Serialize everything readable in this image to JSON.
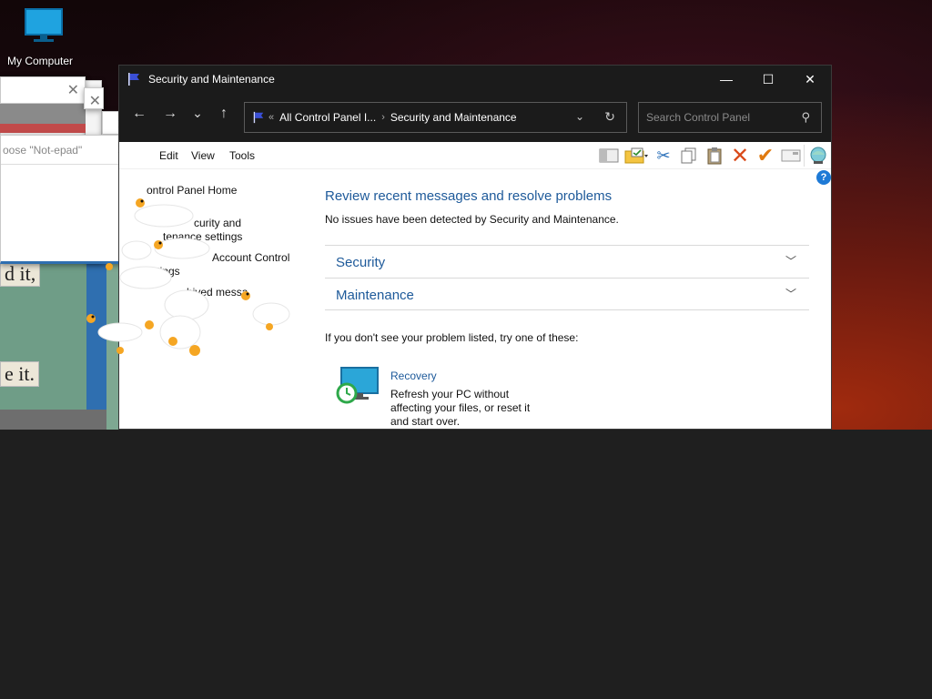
{
  "desktop": {
    "icon_label": "My Computer"
  },
  "background_dialogs": {
    "input_placeholder": "oose \"Not-epad\""
  },
  "poster": {
    "line1": "d it,",
    "line2": "e it."
  },
  "window": {
    "title": "Security and Maintenance",
    "controls": {
      "minimize": "—",
      "maximize": "☐",
      "close": "✕"
    }
  },
  "navigation": {
    "back": "←",
    "forward": "→",
    "recent": "⌄",
    "up": "↑",
    "breadcrumb_overflow": "«",
    "breadcrumb_parent": "All Control Panel I...",
    "breadcrumb_separator": "›",
    "breadcrumb_current": "Security and Maintenance",
    "dropdown": "⌄",
    "refresh": "↻",
    "search_placeholder": "Search Control Panel"
  },
  "menubar": {
    "items": [
      "Edit",
      "View",
      "Tools"
    ]
  },
  "left_pane": {
    "home": "ontrol Panel Home",
    "link1_line1": "curity and",
    "link1_line2": "tenance settings",
    "link2_line1": "Account Control",
    "link2_line2": "ttings",
    "link3": "hived messa"
  },
  "main": {
    "heading": "Review recent messages and resolve problems",
    "status": "No issues have been detected by Security and Maintenance.",
    "sections": [
      {
        "label": "Security"
      },
      {
        "label": "Maintenance"
      }
    ],
    "hint": "If you don't see your problem listed, try one of these:",
    "recovery": {
      "title": "Recovery",
      "description": "Refresh your PC without affecting your files, or reset it and start over."
    }
  },
  "help_badge": "?",
  "colors": {
    "link_blue": "#1e5a9a",
    "titlebar_dark": "#1b1b1b",
    "help_blue": "#1e7ad6"
  }
}
